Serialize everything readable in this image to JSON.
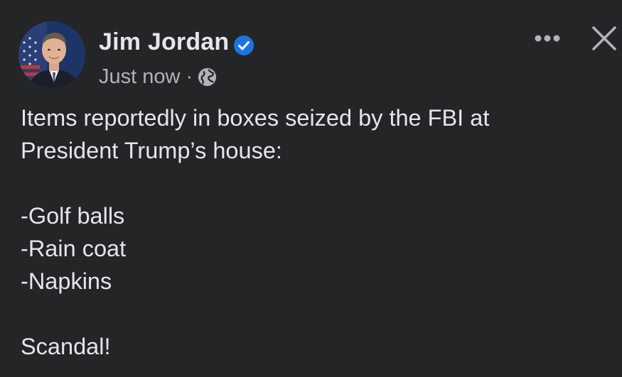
{
  "post": {
    "author": {
      "name": "Jim Jordan",
      "verified": true,
      "avatar_icon": "avatar-portrait"
    },
    "timestamp": "Just now",
    "separator": "·",
    "audience_icon": "globe-icon",
    "actions": {
      "more_icon": "more-horizontal-icon",
      "close_icon": "close-icon"
    },
    "body": {
      "line1": "Items reportedly in boxes seized by the FBI at",
      "line2": "President Trump’s house:",
      "items": [
        "-Golf balls",
        "-Rain coat",
        "-Napkins"
      ],
      "closing": "Scandal!"
    },
    "colors": {
      "background": "#242526",
      "primary_text": "#e4e6eb",
      "secondary_text": "#b0b3b8",
      "verified_badge": "#1b74e4"
    }
  }
}
